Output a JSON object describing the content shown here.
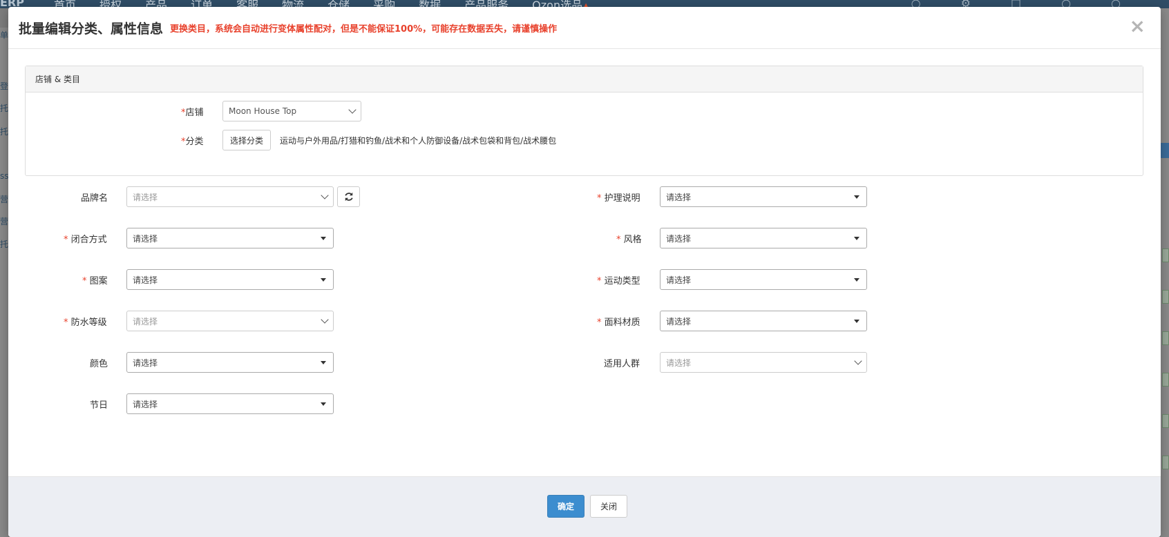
{
  "background": {
    "logo": "ERP",
    "nav": [
      "首页",
      "授权",
      "产品",
      "订单",
      "客服",
      "物流",
      "仓储",
      "采购",
      "数据",
      "产品服务",
      "Ozon选品"
    ],
    "nav_hot_icon": "flame-icon",
    "left_fragments": [
      "单",
      "登",
      "托",
      "托",
      "ss",
      "营",
      "营",
      "托"
    ]
  },
  "modal": {
    "title": "批量编辑分类、属性信息",
    "warning": "更换类目，系统会自动进行变体属性配对，但是不能保证100%，可能存在数据丢失，请谨慎操作",
    "close_icon": "×"
  },
  "panel": {
    "heading": "店铺 & 类目",
    "shop_label": "店铺",
    "shop_value": "Moon House Top",
    "category_label": "分类",
    "category_button": "选择分类",
    "category_path": "运动与户外用品/打猎和钓鱼/战术和个人防御设备/战术包袋和背包/战术腰包"
  },
  "attributes": {
    "brand": {
      "label": "品牌名",
      "value": "请选择",
      "required": false
    },
    "care": {
      "label": "护理说明",
      "value": "请选择",
      "required": true
    },
    "closure": {
      "label": "闭合方式",
      "value": "请选择",
      "required": true
    },
    "style": {
      "label": "风格",
      "value": "请选择",
      "required": true
    },
    "pattern": {
      "label": "图案",
      "value": "请选择",
      "required": true
    },
    "sport": {
      "label": "运动类型",
      "value": "请选择",
      "required": true
    },
    "waterproof": {
      "label": "防水等级",
      "value": "请选择",
      "required": true
    },
    "fabric": {
      "label": "面料材质",
      "value": "请选择",
      "required": true
    },
    "color": {
      "label": "颜色",
      "value": "请选择",
      "required": false
    },
    "audience": {
      "label": "适用人群",
      "value": "请选择",
      "required": false
    },
    "holiday": {
      "label": "节日",
      "value": "请选择",
      "required": false
    }
  },
  "required_mark": "*",
  "refresh_icon": "refresh-icon",
  "footer": {
    "confirm": "确定",
    "close": "关闭"
  },
  "colors": {
    "required": "#e8412c",
    "primary": "#3c8dcf",
    "nav_bg": "#2f4d66"
  }
}
